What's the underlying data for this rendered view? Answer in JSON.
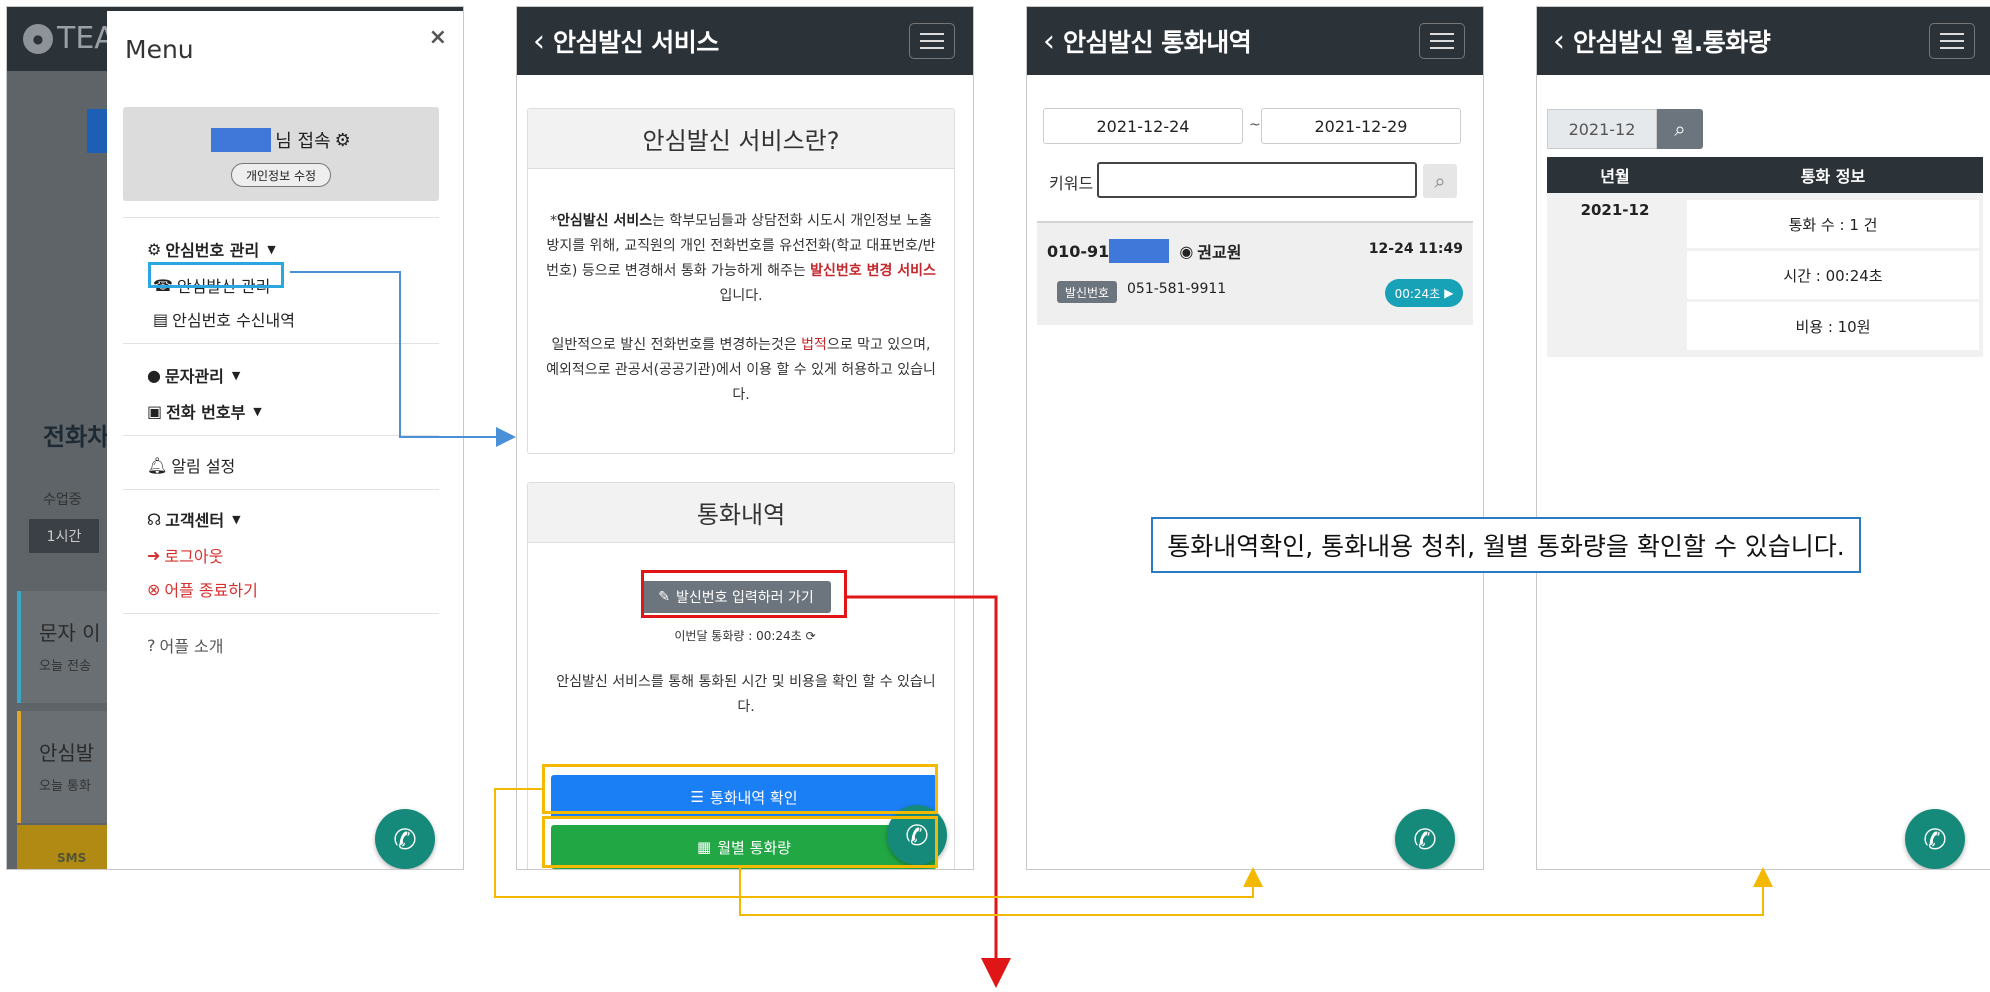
{
  "panel1": {
    "logo_text": "TEA",
    "bg": {
      "section_title1": "전화차",
      "select_label": "수업중",
      "time_button": "1시간",
      "card1_title": "문자 이",
      "card1_sub": "오늘 전송",
      "card2_title": "안심발",
      "card2_sub": "오늘 통화",
      "sms_label": "SMS"
    },
    "menu": {
      "title": "Menu",
      "close": "×",
      "user_suffix": "님 접속",
      "edit_profile": "개인정보 수정",
      "items": [
        {
          "label": "안심번호 관리",
          "icon": "gear-icon"
        },
        {
          "label": "안심발신 관리",
          "icon": "phone-square-icon"
        },
        {
          "label": "안심번호 수신내역",
          "icon": "list-icon"
        },
        {
          "label": "문자관리",
          "icon": "sms-bubble-icon"
        },
        {
          "label": "전화 번호부",
          "icon": "address-book-icon"
        },
        {
          "label": "알림 설정",
          "icon": "bell-icon"
        },
        {
          "label": "고객센터",
          "icon": "headset-icon"
        },
        {
          "label": "로그아웃",
          "icon": "sign-out-icon"
        },
        {
          "label": "어플 종료하기",
          "icon": "x-circle-icon"
        },
        {
          "label": "어플 소개",
          "icon": "question-circle-icon"
        }
      ]
    }
  },
  "panel2": {
    "title": "안심발신 서비스",
    "card1_title": "안심발신 서비스란?",
    "desc1_bold": "안심발신 서비스",
    "desc1_a": "는 학부모님들과 상담전화 시도시 개인정보 노출 방지를 위해, 교직원의 개인 전화번호를 유선전화(학교 대표번호/반 번호) 등으로 변경해서 통화 가능하게 해주는 ",
    "desc1_red": "발신번호 변경 서비스",
    "desc1_b": "입니다.",
    "desc2_a": "일반적으로 발신 전화번호를 변경하는것은 ",
    "desc2_red": "법적",
    "desc2_b": "으로 막고 있으며, 예외적으로 관공서(공공기관)에서 이용 할 수 있게 허용하고 있습니다.",
    "card2_title": "통화내역",
    "input_button": "발신번호 입력하러 가기",
    "monthly_usage": "이번달 통화량 : 00:24초",
    "desc3": "안심발신 서비스를 통해 통화된 시간 및 비용을 확인 할 수 있습니다.",
    "history_button": "통화내역 확인",
    "monthly_button": "월별 통화량"
  },
  "panel3": {
    "title": "안심발신 통화내역",
    "date_from": "2021-12-24",
    "date_sep": "~",
    "date_to": "2021-12-29",
    "keyword_label": "키워드",
    "record": {
      "number_prefix": "010-91",
      "name": "권교원",
      "datetime": "12-24 11:49",
      "caller_badge": "발신번호",
      "caller_number": "051-581-9911",
      "duration": "00:24초"
    }
  },
  "panel4": {
    "title": "안심발신 월.통화량",
    "month": "2021-12",
    "table": {
      "headers": [
        "년월",
        "통화 정보"
      ],
      "ym": "2021-12",
      "count": "통화 수 : 1 건",
      "time": "시간 : 00:24초",
      "cost": "비용 : 10원"
    }
  },
  "callout": "통화내역확인, 통화내용 청취, 월별 통화량을 확인할 수 있습니다.",
  "colors": {
    "dark_bar": "#2b3238",
    "blue_button": "#1a7ef5",
    "green_button": "#22a745",
    "fab": "#168a7a",
    "highlight_red": "#e01515",
    "highlight_yellow": "#f4b800",
    "highlight_blue": "#2aa7e0",
    "arrow_blue": "#4a90d9"
  }
}
